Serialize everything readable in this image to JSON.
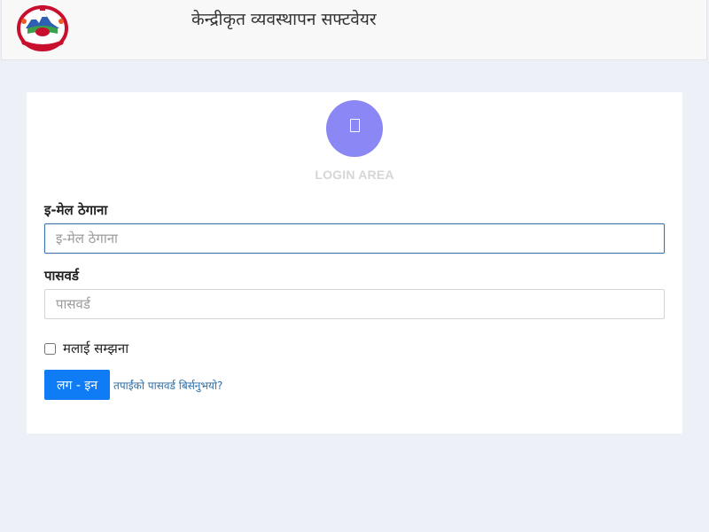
{
  "header": {
    "app_title": "केन्द्रीकृत व्यवस्थापन सफ्टवेयर",
    "logo_icon": "nepal-emblem-icon"
  },
  "login_card": {
    "avatar_icon": "user-avatar-icon",
    "avatar_color": "#8b87f4",
    "section_title": "LOGIN AREA",
    "email_label": "इ-मेल ठेगाना",
    "email_placeholder": "इ-मेल ठेगाना",
    "email_value": "",
    "password_label": "पासवर्ड",
    "password_placeholder": "पासवर्ड",
    "password_value": "",
    "remember_label": "मलाई सम्झना",
    "remember_checked": false,
    "login_button_label": "लग - इन",
    "forgot_password_link": "तपाईंको पासवर्ड बिर्सनुभयो?"
  },
  "colors": {
    "page_background": "#edf0f6",
    "primary_button": "#0f7bf5",
    "link": "#2d6fa8",
    "focused_input_border": "#3d72a6"
  }
}
